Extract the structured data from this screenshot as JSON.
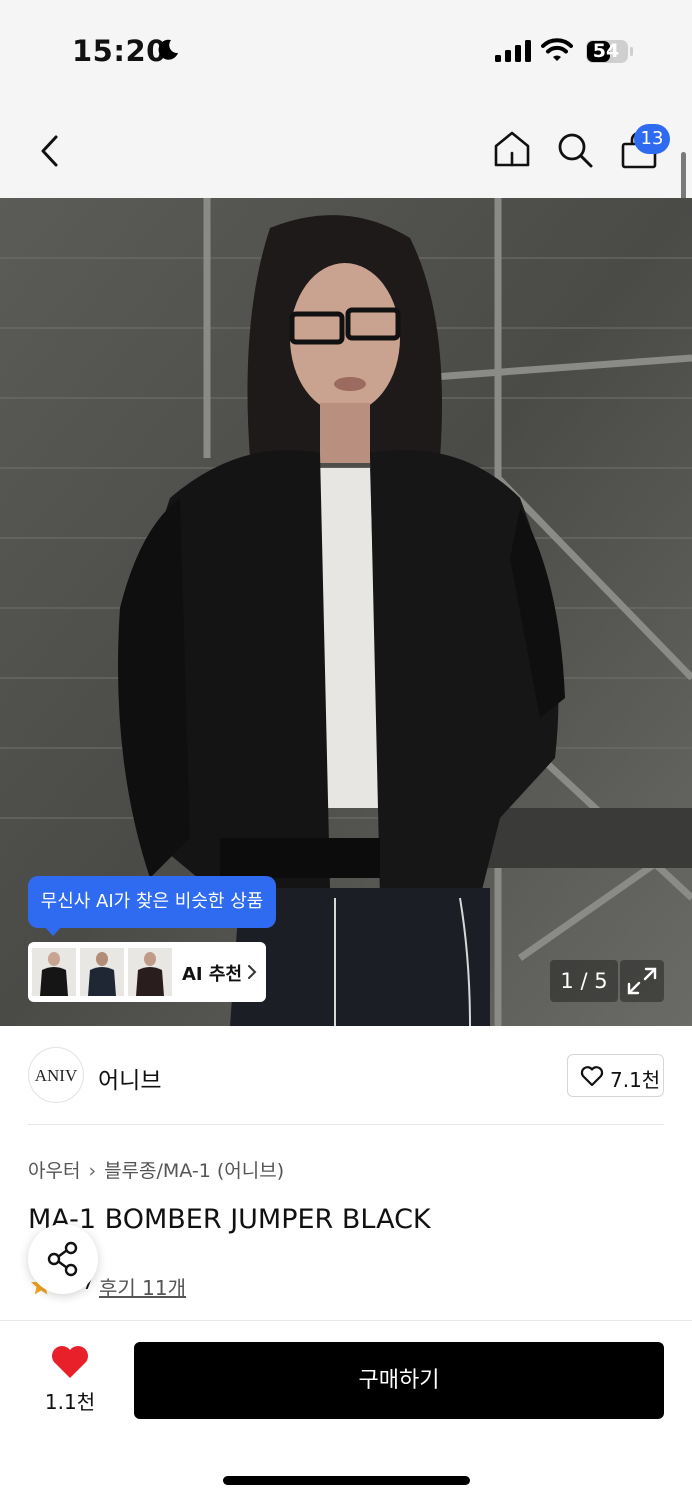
{
  "status_bar": {
    "time": "15:20",
    "battery_level": "54",
    "icons": [
      "moon-icon",
      "cellular-signal-icon",
      "wifi-icon",
      "battery-icon"
    ]
  },
  "nav": {
    "icons": [
      "back-arrow-icon",
      "home-icon",
      "search-icon",
      "shopping-bag-icon"
    ],
    "cart_count": "13"
  },
  "gallery": {
    "ai_tooltip": "무신사 AI가 찾은 비슷한 상품",
    "ai_recommend_label": "AI 추천",
    "page_indicator": "1 / 5",
    "expand_icon": "expand-icon"
  },
  "brand": {
    "logo_text": "ANIV",
    "name": "어니브",
    "like_count": "7.1천"
  },
  "product": {
    "breadcrumb": [
      "아우터",
      "블루종/MA-1 (어니브)"
    ],
    "title": "MA-1 BOMBER JUMPER BLACK",
    "rating": "4.7",
    "review_link": "후기 11개"
  },
  "bottom_bar": {
    "wish_count": "1.1천",
    "buy_label": "구매하기"
  },
  "colors": {
    "accent_blue": "#2f6bf0",
    "heart_red": "#e8202a",
    "star_orange": "#f5a623",
    "buy_button": "#000000"
  }
}
